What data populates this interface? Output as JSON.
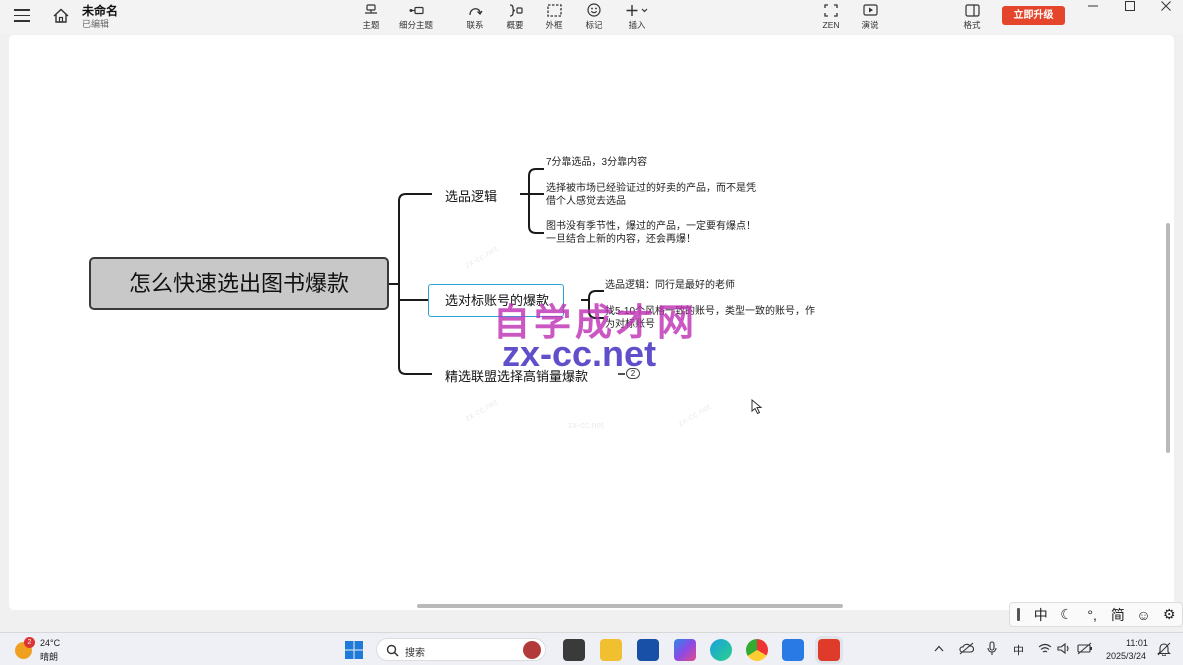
{
  "header": {
    "doc_title": "未命名",
    "doc_status": "已编辑",
    "tools": [
      {
        "label": "主题",
        "icon": "topic-icon"
      },
      {
        "label": "细分主题",
        "icon": "subtopic-icon"
      },
      {
        "label": "联系",
        "icon": "relationship-icon"
      },
      {
        "label": "概要",
        "icon": "summary-icon"
      },
      {
        "label": "外框",
        "icon": "boundary-icon"
      },
      {
        "label": "标记",
        "icon": "marker-icon"
      },
      {
        "label": "插入",
        "icon": "insert-icon"
      },
      {
        "label": "ZEN",
        "icon": "zen-icon"
      },
      {
        "label": "演说",
        "icon": "pitch-icon"
      },
      {
        "label": "格式",
        "icon": "format-icon"
      }
    ],
    "upgrade_label": "立即升级"
  },
  "mindmap": {
    "central": "怎么快速选出图书爆款",
    "branches": [
      {
        "label": "选品逻辑",
        "children": [
          "7分靠选品，3分靠内容",
          "选择被市场已经验证过的好卖的产品，而不是凭\n借个人感觉去选品",
          "图书没有季节性，爆过的产品，一定要有爆点！\n一旦结合上新的内容，还会再爆！"
        ]
      },
      {
        "label": "选对标账号的爆款",
        "children": [
          "选品逻辑：同行是最好的老师",
          "找5-10个风格一致的账号，类型一致的账号，作\n为对标账号"
        ]
      },
      {
        "label": "精选联盟选择高销量爆款",
        "collapsed_count": "2"
      }
    ]
  },
  "watermark": {
    "line1": "自学成才网",
    "line2": "zx-cc.net",
    "faint": "zx-cc.net"
  },
  "ime": {
    "items": [
      "中",
      "☾",
      "°,",
      "简",
      "☺",
      "⚙"
    ]
  },
  "taskbar": {
    "weather_badge": "2",
    "temperature": "24°C",
    "condition": "晴朗",
    "search_placeholder": "搜索",
    "tray_lang": "中",
    "time": "11:01",
    "date": "2025/3/24"
  }
}
